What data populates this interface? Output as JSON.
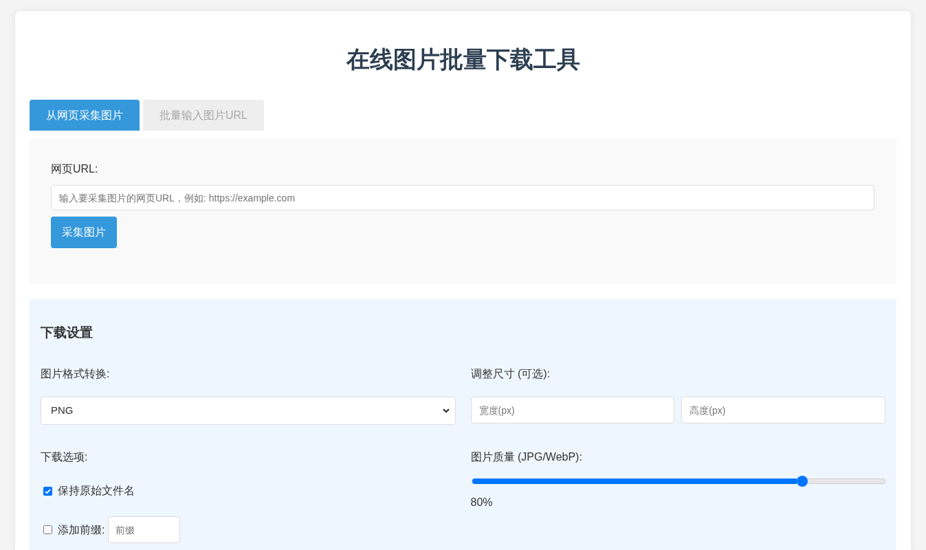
{
  "title": "在线图片批量下载工具",
  "tabs": [
    {
      "label": "从网页采集图片",
      "selected": true
    },
    {
      "label": "批量输入图片URL",
      "selected": false
    }
  ],
  "url_panel": {
    "label": "网页URL:",
    "field": {
      "placeholder": "输入要采集图片的网页URL，例如: https://example.com"
    },
    "button": "采集图片"
  },
  "settings": {
    "heading": "下载设置",
    "format": {
      "label": "图片格式转换:",
      "value": "PNG"
    },
    "resize": {
      "label": "调整尺寸 (可选):",
      "fields": [
        {
          "placeholder": "宽度(px)"
        },
        {
          "placeholder": "高度(px)"
        }
      ]
    },
    "options": {
      "label": "下载选项:",
      "items": [
        {
          "kind": "checkbox",
          "label": "保持原始文件名",
          "checked": true
        },
        {
          "kind": "checkbox_input",
          "label": "添加前缀:",
          "checked": false,
          "field": {
            "placeholder": "前缀"
          }
        }
      ]
    },
    "quality": {
      "label": "图片质量 (JPG/WebP):",
      "level": 0.8,
      "reading": "80%"
    }
  }
}
